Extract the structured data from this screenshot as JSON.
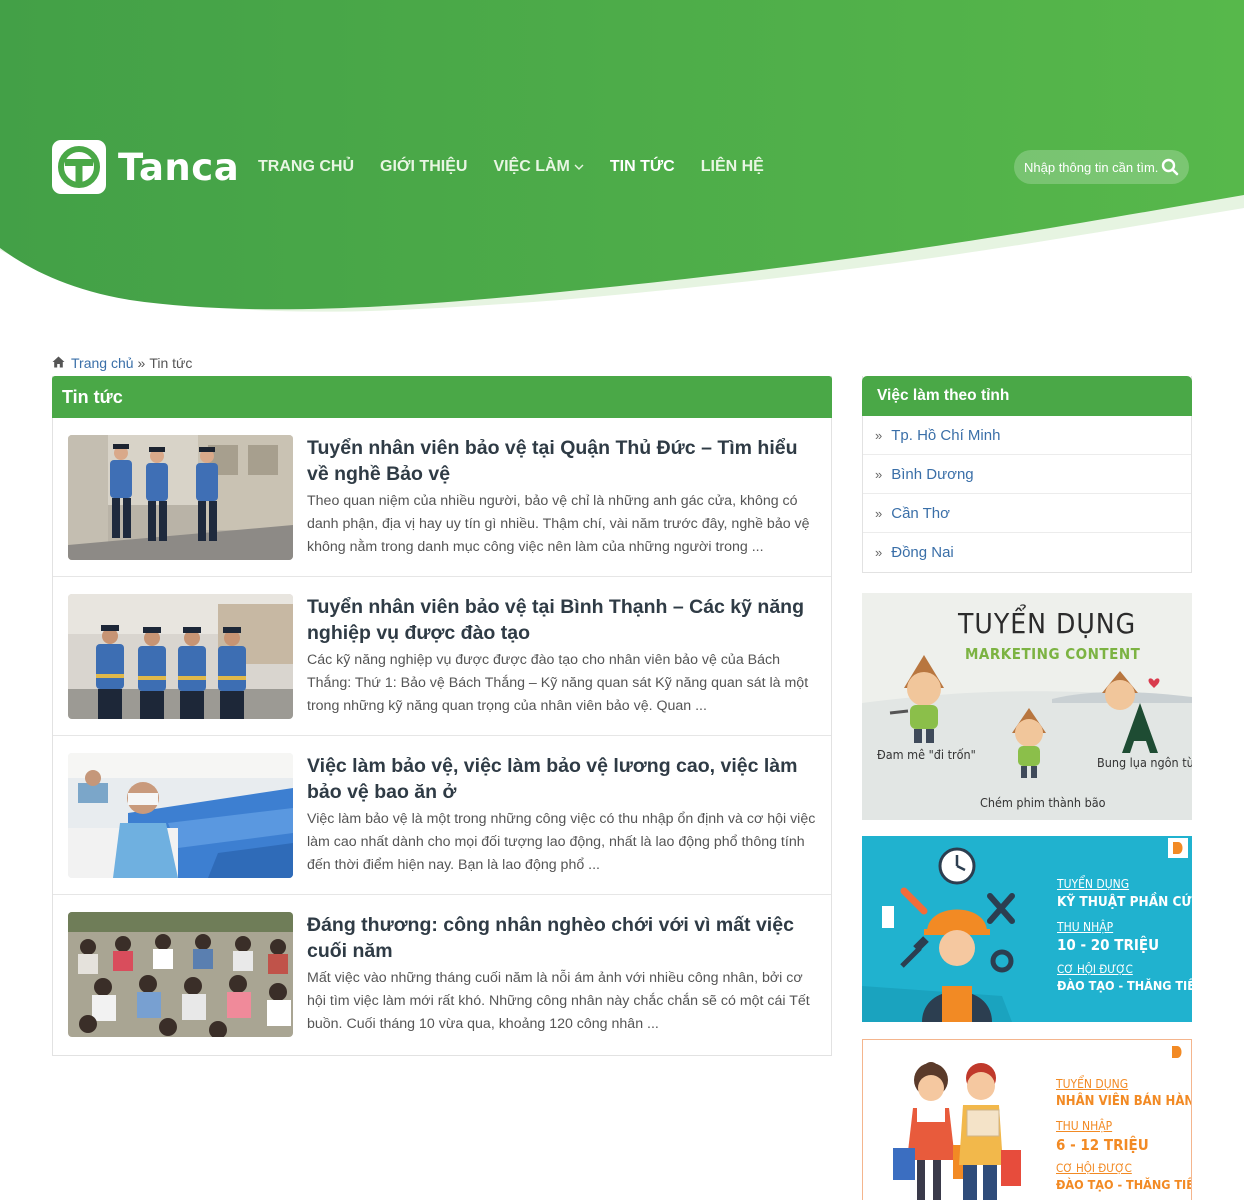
{
  "header": {
    "logo_text": "Tanca",
    "nav": [
      {
        "label": "TRANG CHỦ"
      },
      {
        "label": "GIỚI THIỆU"
      },
      {
        "label": "VIỆC LÀM"
      },
      {
        "label": "TIN TỨC"
      },
      {
        "label": "LIÊN HỆ"
      }
    ],
    "search_placeholder": "Nhập thông tin cần tìm..."
  },
  "breadcrumb": {
    "home": "Trang chủ",
    "separator": "»",
    "current": "Tin tức"
  },
  "main": {
    "heading": "Tin tức",
    "articles": [
      {
        "title": "Tuyển nhân viên bảo vệ tại Quận Thủ Đức – Tìm hiểu về nghề Bảo vệ",
        "excerpt": "Theo quan niệm của nhiều người, bảo vệ chỉ là những anh gác cửa, không có danh phận, địa vị hay uy tín gì nhiều. Thậm chí, vài năm trước đây, nghề bảo vệ không nằm trong danh mục công việc nên làm của những người trong ..."
      },
      {
        "title": "Tuyển nhân viên bảo vệ tại Bình Thạnh – Các kỹ năng nghiệp vụ được đào tạo",
        "excerpt": "Các kỹ năng nghiệp vụ được được đào tạo cho nhân viên bảo vệ của Bách Thắng: Thứ 1:  Bảo vệ Bách Thắng – Kỹ năng quan sát Kỹ năng quan sát là một trong những kỹ năng quan trọng của nhân viên bảo vệ. Quan ..."
      },
      {
        "title": "Việc làm bảo vệ, việc làm bảo vệ lương cao, việc làm bảo vệ bao ăn ở",
        "excerpt": " Việc làm bảo vệ là một trong những công việc có thu nhập ổn định và cơ hội việc làm cao nhất dành cho mọi đối tượng lao động, nhất là lao động phổ thông tính đến thời điểm hiện nay. Bạn là lao động phổ ..."
      },
      {
        "title": "Đáng thương: công nhân nghèo chới với vì mất việc cuối năm",
        "excerpt": "Mất việc vào những tháng cuối năm là nỗi ám ảnh với nhiều công nhân, bởi cơ hội tìm việc làm mới rất khó. Những công nhân này chắc chắn sẽ có một cái Tết buồn. Cuối tháng 10 vừa qua, khoảng 120 công nhân ..."
      }
    ]
  },
  "sidebar": {
    "heading": "Việc làm theo tỉnh",
    "items": [
      {
        "label": "Tp. Hồ Chí Minh"
      },
      {
        "label": "Bình Dương"
      },
      {
        "label": "Cần Thơ"
      },
      {
        "label": "Đồng Nai"
      }
    ],
    "banner1": {
      "title": "TUYỂN DỤNG",
      "subtitle": "MARKETING CONTENT",
      "cap1": "Đam mê \"đi trốn\"",
      "cap2": "Chém phim thành bão",
      "cap3": "Bung lụa ngôn từ"
    },
    "banner2": {
      "l1": "TUYỂN DỤNG",
      "l2": "KỸ THUẬT PHẦN CỨNG",
      "l3": "THU NHẬP",
      "l4": "10 - 20 TRIỆU",
      "l5": "CƠ HỘI ĐƯỢC",
      "l6": "ĐÀO TẠO - THĂNG TIẾN"
    },
    "banner3": {
      "l1": "TUYỂN DỤNG",
      "l2": "NHÂN VIÊN BÁN HÀNG",
      "l3": "THU NHẬP",
      "l4": "6 - 12 TRIỆU",
      "l5": "CƠ HỘI ĐƯỢC",
      "l6": "ĐÀO TẠO - THĂNG TIẾN"
    }
  },
  "colors": {
    "brand_green": "#4aa847",
    "link_blue": "#3a6fa8",
    "banner_cyan": "#20b2cf",
    "banner_orange": "#f28a24"
  }
}
